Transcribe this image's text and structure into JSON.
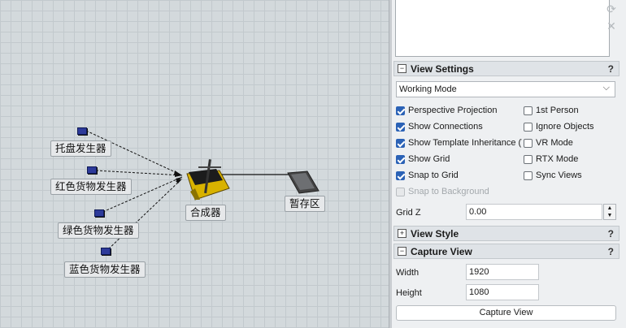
{
  "viewport": {
    "nodes": {
      "pallet_source": "托盘发生器",
      "red_source": "红色货物发生器",
      "green_source": "绿色货物发生器",
      "blue_source": "蓝色货物发生器",
      "combiner": "合成器",
      "queue": "暂存区"
    }
  },
  "panel": {
    "side_icons": [
      "refresh-icon",
      "close-icon"
    ],
    "view_settings": {
      "title": "View Settings",
      "help": "?",
      "mode_value": "Working Mode",
      "options_left": [
        {
          "label": "Perspective Projection",
          "checked": true
        },
        {
          "label": "Show Connections",
          "checked": true
        },
        {
          "label": "Show Template Inheritance (T",
          "checked": true
        },
        {
          "label": "Show Grid",
          "checked": true
        },
        {
          "label": "Snap to Grid",
          "checked": true
        },
        {
          "label": "Snap to Background",
          "checked": false,
          "disabled": true
        }
      ],
      "options_right": [
        {
          "label": "1st Person",
          "checked": false
        },
        {
          "label": "Ignore Objects",
          "checked": false
        },
        {
          "label": "VR Mode",
          "checked": false
        },
        {
          "label": "RTX Mode",
          "checked": false
        },
        {
          "label": "Sync Views",
          "checked": false
        }
      ],
      "grid_z_label": "Grid Z",
      "grid_z_value": "0.00"
    },
    "view_style": {
      "title": "View Style",
      "help": "?"
    },
    "capture_view": {
      "title": "Capture View",
      "help": "?",
      "width_label": "Width",
      "width_value": "1920",
      "height_label": "Height",
      "height_value": "1080",
      "button_label": "Capture View"
    }
  }
}
